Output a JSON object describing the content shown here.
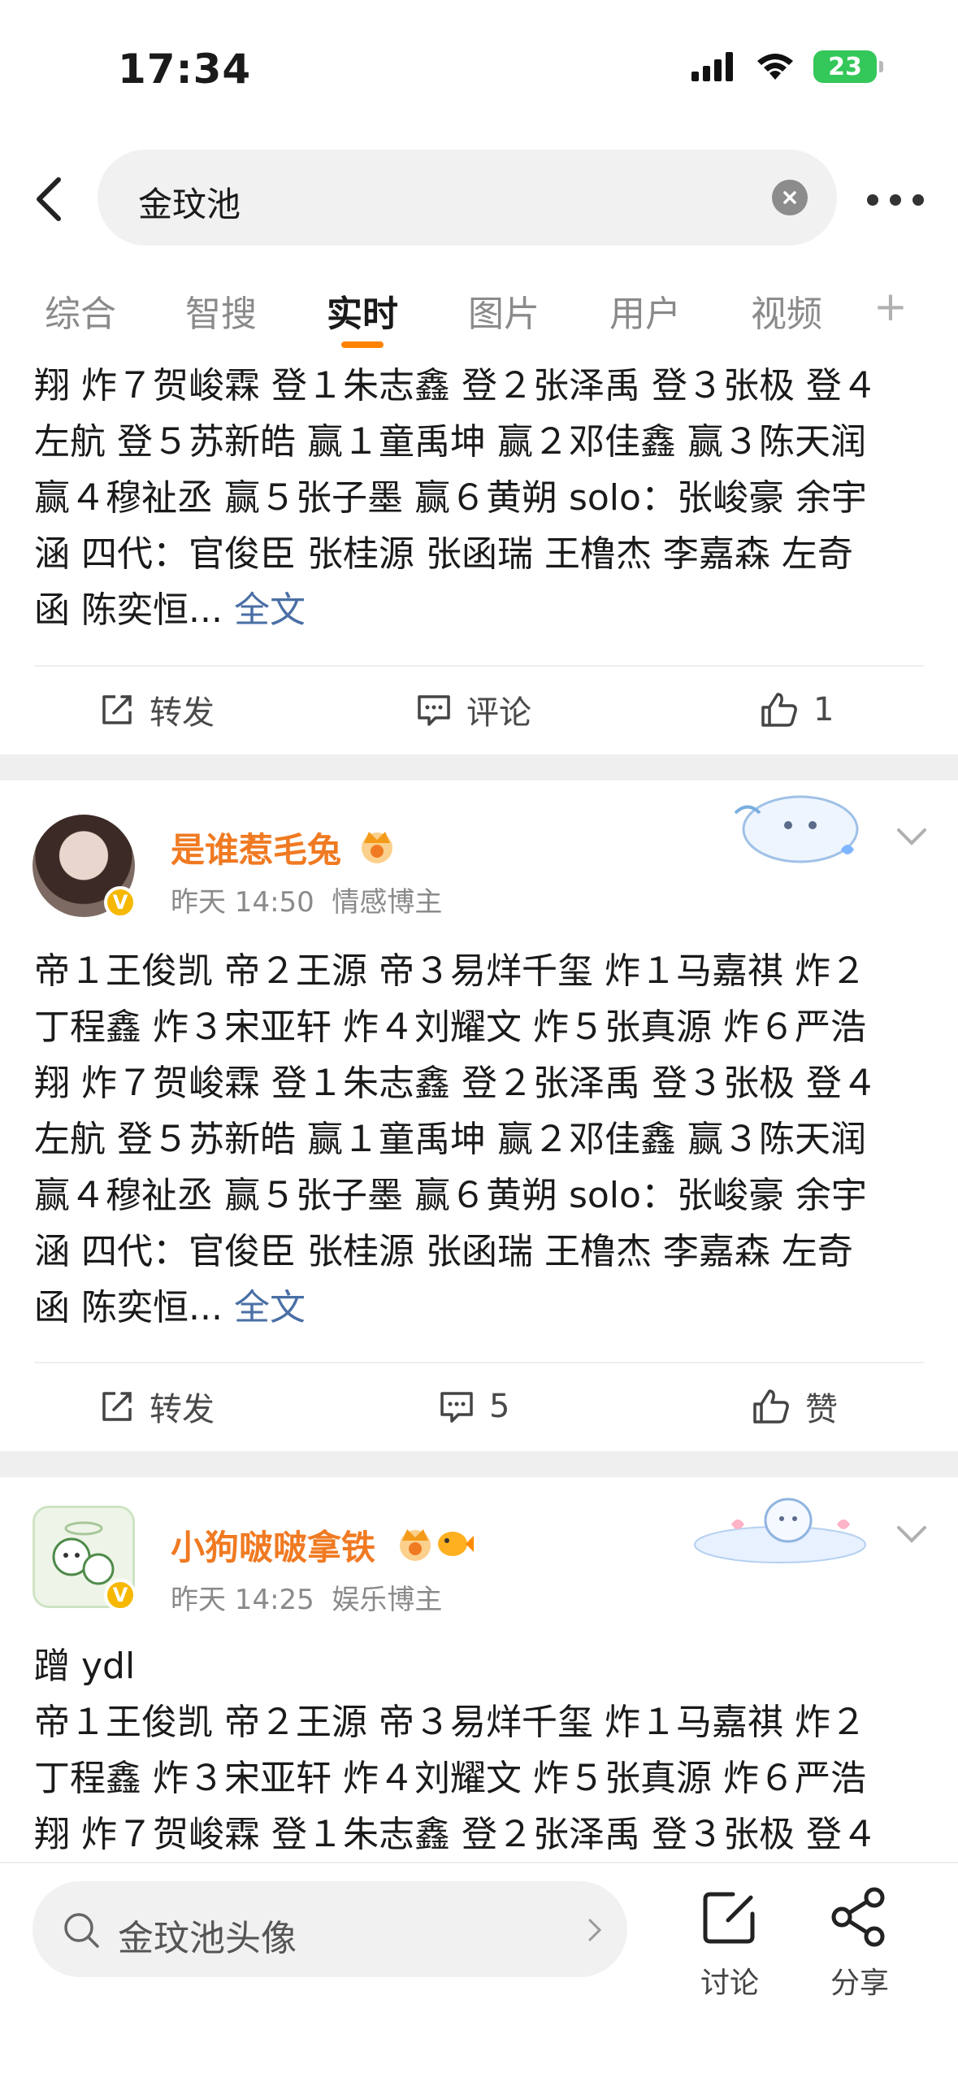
{
  "status_bar": {
    "time": "17:34",
    "battery": "23"
  },
  "search": {
    "query": "金玟池"
  },
  "tabs": [
    {
      "label": "综合",
      "active": false
    },
    {
      "label": "智搜",
      "active": false
    },
    {
      "label": "实时",
      "active": true
    },
    {
      "label": "图片",
      "active": false
    },
    {
      "label": "用户",
      "active": false
    },
    {
      "label": "视频",
      "active": false
    }
  ],
  "tab_more": "+",
  "posts": [
    {
      "lines": [
        "翔 炸７贺峻霖 登１朱志鑫 登２张泽禹 登３张极 登４",
        "左航 登５苏新皓 赢１童禹坤 赢２邓佳鑫 赢３陈天润",
        "赢４穆祉丞 赢５张子墨 赢６黄朔  solo：张峻豪 余宇",
        "涵  四代：官俊臣 张桂源 张函瑞 王橹杰 李嘉森 左奇",
        "函 陈奕恒..."
      ],
      "more_label": "全文",
      "actions": {
        "repost": "转发",
        "comment": "评论",
        "like": "1"
      }
    },
    {
      "username": "是谁惹毛兔",
      "time": "昨天 14:50",
      "tag": "情感博主",
      "lines": [
        "帝１王俊凯 帝２王源 帝３易烊千玺 炸１马嘉祺 炸２",
        "丁程鑫 炸３宋亚轩 炸４刘耀文 炸５张真源 炸６严浩",
        "翔 炸７贺峻霖 登１朱志鑫 登２张泽禹 登３张极 登４",
        "左航 登５苏新皓 赢１童禹坤 赢２邓佳鑫 赢３陈天润",
        "赢４穆祉丞 赢５张子墨 赢６黄朔 solo：张峻豪 余宇",
        "涵 四代：官俊臣 张桂源 张函瑞 王橹杰 李嘉森 左奇",
        "函 陈奕恒..."
      ],
      "more_label": "全文",
      "actions": {
        "repost": "转发",
        "comment": "5",
        "like": "赞"
      }
    },
    {
      "username": "小狗啵啵拿铁",
      "time": "昨天 14:25",
      "tag": "娱乐博主",
      "lines": [
        "蹭 ydl",
        "帝１王俊凯 帝２王源 帝３易烊千玺 炸１马嘉祺 炸２",
        "丁程鑫 炸３宋亚轩 炸４刘耀文 炸５张真源 炸６严浩",
        "翔 炸７贺峻霖 登１朱志鑫 登２张泽禹 登３张极 登４"
      ]
    }
  ],
  "bottom_bar": {
    "search_text": "金玟池头像",
    "discuss_label": "讨论",
    "share_label": "分享"
  },
  "colors": {
    "accent": "#ff8200",
    "username": "#f07a22",
    "link": "#4a6fa5"
  }
}
